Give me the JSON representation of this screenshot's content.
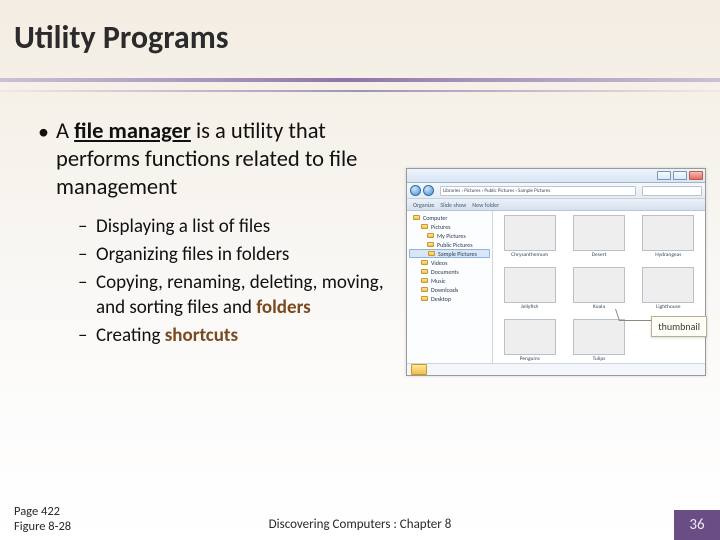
{
  "title": "Utility Programs",
  "main": {
    "prefix": "A ",
    "term": "file manager",
    "rest": " is a utility that performs functions related to file management"
  },
  "subs": [
    {
      "text": "Displaying a list of files"
    },
    {
      "text": "Organizing files in folders"
    },
    {
      "text_pre": "Copying, renaming, deleting, moving, and sorting files and ",
      "em": "folders"
    },
    {
      "text_pre": "Creating ",
      "em": "shortcuts"
    }
  ],
  "figure": {
    "address": "Libraries › Pictures › Public Pictures › Sample Pictures",
    "cmd": [
      "Organize",
      "Slide show",
      "New folder"
    ],
    "tree": {
      "root": "Computer",
      "items": [
        "Pictures",
        "My Pictures",
        "Public Pictures",
        "Sample Pictures",
        "Videos",
        "Documents",
        "Music",
        "Downloads",
        "Desktop"
      ]
    },
    "thumbs": [
      "Chrysanthemum",
      "Desert",
      "Hydrangeas",
      "Jellyfish",
      "Koala",
      "Lighthouse",
      "Penguins",
      "Tulips"
    ],
    "callout": "thumbnail"
  },
  "footer": {
    "page_ref_1": "Page 422",
    "page_ref_2": "Figure 8-28",
    "center": "Discovering Computers : Chapter 8",
    "number": "36"
  }
}
